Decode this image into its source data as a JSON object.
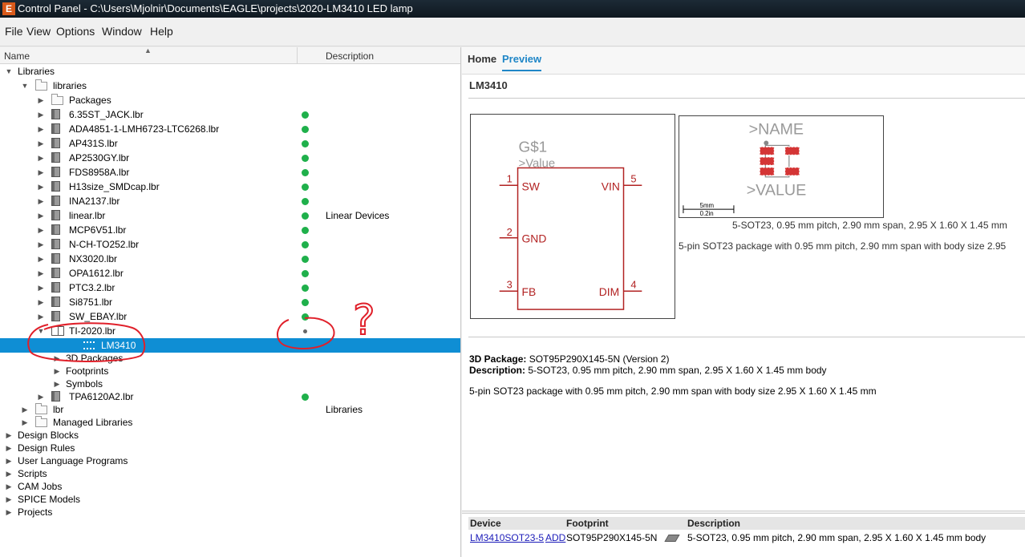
{
  "window": {
    "title": "Control Panel - C:\\Users\\Mjolnir\\Documents\\EAGLE\\projects\\2020-LM3410 LED lamp",
    "app_icon_letter": "E"
  },
  "menu": [
    "File",
    "View",
    "Options",
    "Window",
    "Help"
  ],
  "tree": {
    "headers": {
      "name": "Name",
      "description": "Description"
    },
    "rows": [
      {
        "label": "Libraries",
        "level": 0,
        "arrow": "down",
        "icon": "none"
      },
      {
        "label": "libraries",
        "level": 1,
        "arrow": "down",
        "icon": "open-folder"
      },
      {
        "label": "Packages",
        "level": 2,
        "arrow": "right",
        "icon": "folder"
      },
      {
        "label": "6.35ST_JACK.lbr",
        "level": 2,
        "arrow": "right",
        "icon": "book",
        "status": "green"
      },
      {
        "label": "ADA4851-1-LMH6723-LTC6268.lbr",
        "level": 2,
        "arrow": "right",
        "icon": "book",
        "status": "green"
      },
      {
        "label": "AP431S.lbr",
        "level": 2,
        "arrow": "right",
        "icon": "book",
        "status": "green"
      },
      {
        "label": "AP2530GY.lbr",
        "level": 2,
        "arrow": "right",
        "icon": "book",
        "status": "green"
      },
      {
        "label": "FDS8958A.lbr",
        "level": 2,
        "arrow": "right",
        "icon": "book",
        "status": "green"
      },
      {
        "label": "H13size_SMDcap.lbr",
        "level": 2,
        "arrow": "right",
        "icon": "book",
        "status": "green"
      },
      {
        "label": "INA2137.lbr",
        "level": 2,
        "arrow": "right",
        "icon": "book",
        "status": "green"
      },
      {
        "label": "linear.lbr",
        "level": 2,
        "arrow": "right",
        "icon": "book",
        "status": "green",
        "description": "Linear Devices"
      },
      {
        "label": "MCP6V51.lbr",
        "level": 2,
        "arrow": "right",
        "icon": "book",
        "status": "green"
      },
      {
        "label": "N-CH-TO252.lbr",
        "level": 2,
        "arrow": "right",
        "icon": "book",
        "status": "green"
      },
      {
        "label": "NX3020.lbr",
        "level": 2,
        "arrow": "right",
        "icon": "book",
        "status": "green"
      },
      {
        "label": "OPA1612.lbr",
        "level": 2,
        "arrow": "right",
        "icon": "book",
        "status": "green"
      },
      {
        "label": "PTC3.2.lbr",
        "level": 2,
        "arrow": "right",
        "icon": "book",
        "status": "green"
      },
      {
        "label": "Si8751.lbr",
        "level": 2,
        "arrow": "right",
        "icon": "book",
        "status": "green"
      },
      {
        "label": "SW_EBAY.lbr",
        "level": 2,
        "arrow": "right",
        "icon": "book",
        "status": "green"
      },
      {
        "label": "TI-2020.lbr",
        "level": 2,
        "arrow": "down",
        "icon": "open-book",
        "status": "grey"
      },
      {
        "label": "LM3410",
        "level": 4,
        "arrow": "none",
        "icon": "device",
        "selected": true
      },
      {
        "label": "3D Packages",
        "level": 3,
        "arrow": "right",
        "icon": "none"
      },
      {
        "label": "Footprints",
        "level": 3,
        "arrow": "right",
        "icon": "none"
      },
      {
        "label": "Symbols",
        "level": 3,
        "arrow": "right",
        "icon": "none"
      },
      {
        "label": "TPA6120A2.lbr",
        "level": 2,
        "arrow": "right",
        "icon": "book",
        "status": "green"
      },
      {
        "label": "lbr",
        "level": 1,
        "arrow": "right",
        "icon": "folder",
        "description": "Libraries"
      },
      {
        "label": "Managed Libraries",
        "level": 1,
        "arrow": "right",
        "icon": "folder"
      },
      {
        "label": "Design Blocks",
        "level": 0,
        "arrow": "right",
        "icon": "none"
      },
      {
        "label": "Design Rules",
        "level": 0,
        "arrow": "right",
        "icon": "none"
      },
      {
        "label": "User Language Programs",
        "level": 0,
        "arrow": "right",
        "icon": "none"
      },
      {
        "label": "Scripts",
        "level": 0,
        "arrow": "right",
        "icon": "none"
      },
      {
        "label": "CAM Jobs",
        "level": 0,
        "arrow": "right",
        "icon": "none"
      },
      {
        "label": "SPICE Models",
        "level": 0,
        "arrow": "right",
        "icon": "none"
      },
      {
        "label": "Projects",
        "level": 0,
        "arrow": "right",
        "icon": "none"
      }
    ]
  },
  "annotation": {
    "question_mark": "?"
  },
  "preview": {
    "tabs": [
      "Home",
      "Preview"
    ],
    "active_tab": "Preview",
    "device_title": "LM3410",
    "symbol": {
      "name": "G$1",
      "value": ">Value",
      "pins": [
        {
          "num": "1",
          "name": "SW"
        },
        {
          "num": "2",
          "name": "GND"
        },
        {
          "num": "3",
          "name": "FB"
        },
        {
          "num": "5",
          "name": "VIN"
        },
        {
          "num": "4",
          "name": "DIM"
        }
      ],
      "color": "#b22222"
    },
    "footprint": {
      "name": ">NAME",
      "value": ">VALUE",
      "scale_top": "5mm",
      "scale_bottom": "0.2in",
      "pad_color": "#d43535"
    },
    "fp_line1": "5-SOT23, 0.95 mm pitch, 2.90 mm span, 2.95 X 1.60 X 1.45 mm",
    "fp_line2": "5-pin SOT23 package with 0.95 mm pitch, 2.90 mm span with body size 2.95",
    "package_label": "3D Package:",
    "package_value": "SOT95P290X145-5N (Version 2)",
    "description_label": "Description:",
    "description_value": "5-SOT23, 0.95 mm pitch, 2.90 mm span, 2.95 X 1.60 X 1.45 mm body",
    "long_description": "5-pin SOT23 package with 0.95 mm pitch, 2.90 mm span with body size 2.95 X 1.60 X 1.45 mm",
    "table": {
      "headers": [
        "Device",
        "Footprint",
        "Description"
      ],
      "row": {
        "device": "LM3410SOT23-5",
        "add": "ADD",
        "footprint": "SOT95P290X145-5N",
        "description": "5-SOT23, 0.95 mm pitch, 2.90 mm span, 2.95 X 1.60 X 1.45 mm body"
      }
    }
  }
}
